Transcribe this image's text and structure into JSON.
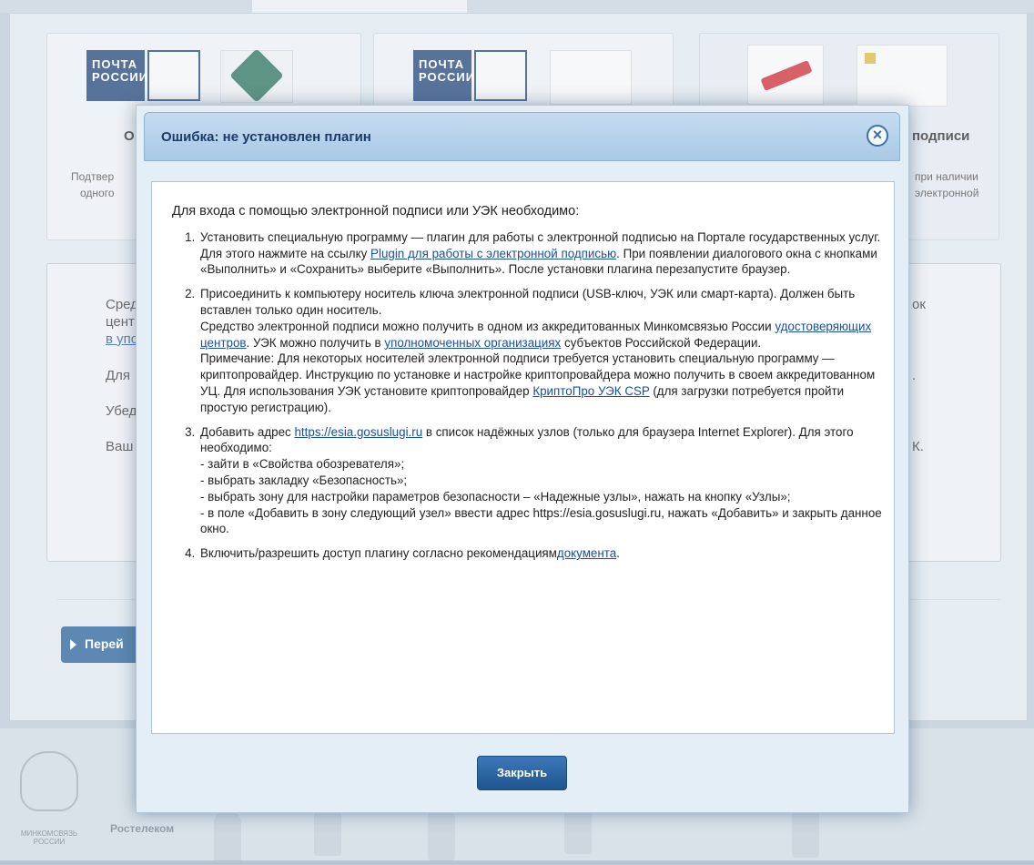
{
  "background": {
    "card1": {
      "title_fragment": "О",
      "desc_lines": [
        "Подтвер",
        "одного"
      ],
      "logo_text": [
        "ПОЧТА",
        "РОССИИ"
      ]
    },
    "card2": {
      "logo_text": [
        "ПОЧТА",
        "РОССИИ"
      ]
    },
    "card3": {
      "title_fragment": "подписи",
      "desc_lines": [
        "при наличии",
        "электронной"
      ]
    },
    "left_fragments": [
      {
        "text": "Сред",
        "link": false
      },
      {
        "text": "цент",
        "link": false
      },
      {
        "text": "в упо",
        "link": true
      },
      {
        "text": "Для",
        "link": false
      },
      {
        "text": "Убед",
        "link": false
      },
      {
        "text": "Ваш",
        "link": false
      }
    ],
    "right_fragments": [
      "ок",
      ".",
      "К."
    ],
    "go_button_label": "Перей",
    "footer": {
      "ministry_label": [
        "МИНКОМСВЯЗЬ",
        "РОССИИ"
      ],
      "rostelecom_label": "Ростелеком"
    }
  },
  "modal": {
    "title": "Ошибка: не установлен плагин",
    "close_icon": "close-circle-icon",
    "intro": "Для входа с помощью электронной подписи или УЭК необходимо:",
    "step1": {
      "text_a": "Установить специальную программу — плагин для работы с электронной подписью на Портале государственных услуг. Для этого нажмите на ссылку ",
      "link": "Plugin для работы с электронной подписью",
      "text_b": ". При появлении диалогового окна с кнопками «Выполнить» и «Сохранить» выберите «Выполнить». После установки плагина перезапустите браузер."
    },
    "step2": {
      "text_a": "Присоединить к компьютеру носитель ключа электронной подписи (USB-ключ, УЭК или смарт-карта). Должен быть вставлен только один носитель.",
      "text_b": "Средство электронной подписи можно получить в одном из аккредитованных Минкомсвязью России ",
      "link_1": "удостоверяющих центров",
      "text_c": ". УЭК можно получить в ",
      "link_2": "уполномоченных организациях",
      "text_d": " субъектов Российской Федерации.",
      "text_e": "Примечание: Для некоторых носителей электронной подписи требуется установить специальную программу — криптопровайдер. Инструкцию по установке и настройке криптопровайдера можно получить в своем аккредитованном УЦ. Для использования УЭК установите криптопровайдер ",
      "link_3": "КриптоПро УЭК CSP",
      "text_f": " (для загрузки потребуется пройти простую регистрацию)."
    },
    "step3": {
      "text_a": "Добавить адрес ",
      "link": "https://esia.gosuslugi.ru",
      "text_b": " в список надёжных узлов (только для браузера Internet Explorer). Для этого необходимо:",
      "items": [
        "- зайти в «Свойства обозревателя»;",
        "- выбрать закладку «Безопасность»;",
        "- выбрать зону для настройки параметров безопасности – «Надежные узлы», нажать на кнопку «Узлы»;",
        "- в поле «Добавить в зону следующий узел» ввести адрес https://esia.gosuslugi.ru, нажать «Добавить» и закрыть данное окно."
      ]
    },
    "step4": {
      "text_a": "Включить/разрешить доступ плагину согласно рекомендациям",
      "link": "документа",
      "text_b": "."
    },
    "close_button_label": "Закрыть"
  },
  "colors": {
    "modal_header": "#a9c9e6",
    "link": "#1a4fa0",
    "button": "#1f558f",
    "page_bg": "#dce5ee"
  }
}
